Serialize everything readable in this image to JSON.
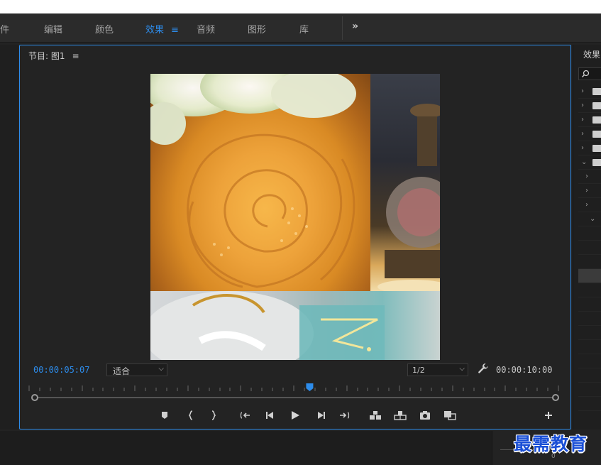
{
  "workspace_tabs": [
    {
      "label": "件",
      "active": false
    },
    {
      "label": "编辑",
      "active": false
    },
    {
      "label": "颜色",
      "active": false
    },
    {
      "label": "效果",
      "active": true
    },
    {
      "label": "音频",
      "active": false
    },
    {
      "label": "图形",
      "active": false
    },
    {
      "label": "库",
      "active": false
    }
  ],
  "workspace_more": "»",
  "program_monitor": {
    "title": "节目: 图1",
    "menu_icon": "≡",
    "current_timecode": "00:00:05:07",
    "fit_select": {
      "value": "适合"
    },
    "resolution_select": {
      "value": "1/2"
    },
    "duration_timecode": "00:00:10:00",
    "playhead_fraction": 0.53,
    "transport_buttons": [
      "add-marker-icon",
      "mark-in-icon",
      "mark-out-icon",
      "go-to-in-icon",
      "step-back-icon",
      "play-icon",
      "step-forward-icon",
      "go-to-out-icon",
      "insert-icon",
      "overwrite-icon",
      "export-frame-icon",
      "compare-view-icon",
      "add-button-icon"
    ]
  },
  "effects_panel": {
    "title": "效果"
  },
  "meter_zero": "0",
  "watermark": "最需教育",
  "colors": {
    "accent": "#2d8ceb",
    "panel_bg": "#232323",
    "watermark": "#1a4fd6"
  }
}
